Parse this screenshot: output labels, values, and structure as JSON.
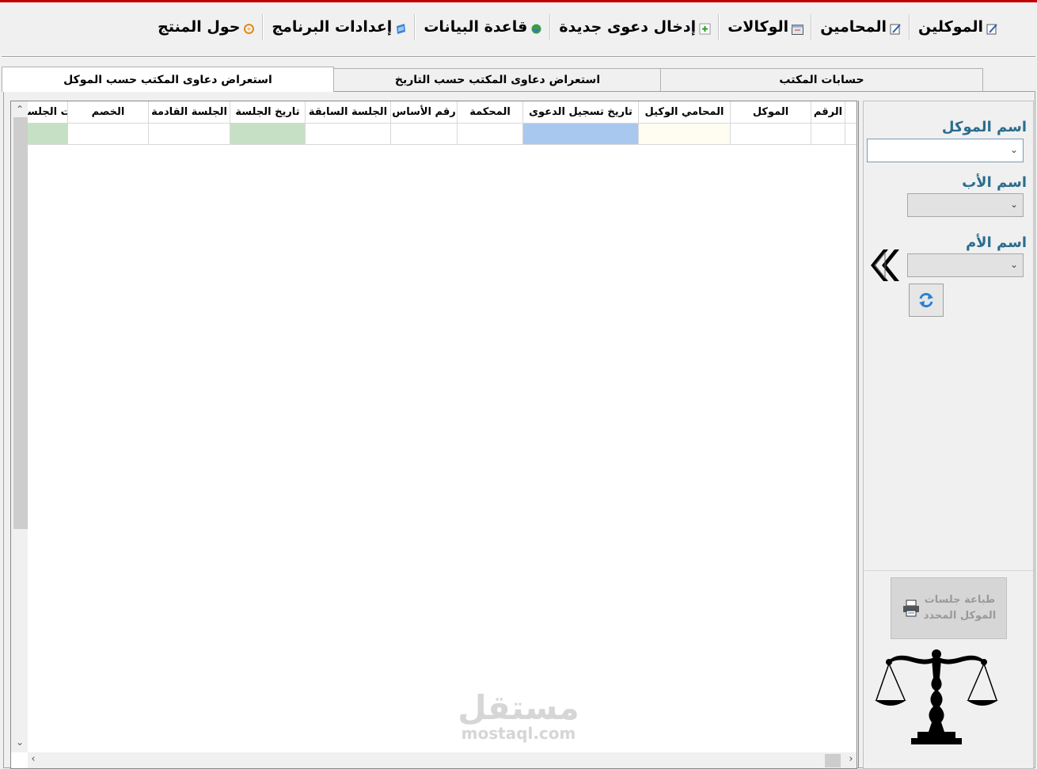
{
  "menu": {
    "items": [
      {
        "label": "الموكلين",
        "icon": "edit-icon"
      },
      {
        "label": "المحامين",
        "icon": "edit-icon"
      },
      {
        "label": "الوكالات",
        "icon": "window-icon"
      },
      {
        "label": "إدخال دعوى جديدة",
        "icon": "add-icon"
      },
      {
        "label": "قاعدة البيانات",
        "icon": "database-icon"
      },
      {
        "label": "إعدادات البرنامج",
        "icon": "settings-icon"
      },
      {
        "label": "حول المنتج",
        "icon": "info-icon"
      }
    ]
  },
  "tabs": [
    {
      "label": "استعراض دعاوى المكتب حسب الموكل",
      "active": true
    },
    {
      "label": "استعراض دعاوى المكتب حسب التاريخ",
      "active": false
    },
    {
      "label": "حسابات المكتب",
      "active": false
    }
  ],
  "grid": {
    "columns": [
      {
        "label": "الرقم",
        "cell_color": "#ffffff"
      },
      {
        "label": "الموكل",
        "cell_color": "#ffffff"
      },
      {
        "label": "المحامي الوكيل",
        "cell_color": "#fffcf2"
      },
      {
        "label": "تاريخ تسجيل الدعوى",
        "cell_color": "#a8c8ef"
      },
      {
        "label": "المحكمة",
        "cell_color": "#ffffff"
      },
      {
        "label": "رقم الأساس",
        "cell_color": "#ffffff"
      },
      {
        "label": "الجلسة السابقة",
        "cell_color": "#ffffff"
      },
      {
        "label": "تاريخ الجلسة",
        "cell_color": "#c6e0c6"
      },
      {
        "label": "الجلسة القادمة",
        "cell_color": "#ffffff"
      },
      {
        "label": "الخصم",
        "cell_color": "#ffffff"
      },
      {
        "label": "ملاحظات الجلسة",
        "cell_color": "#c6e0c6"
      }
    ]
  },
  "filters": {
    "client_name_label": "اسم الموكل",
    "father_name_label": "اسم الأب",
    "mother_name_label": "اسم الأم",
    "client_name_value": "",
    "father_name_value": "",
    "mother_name_value": ""
  },
  "print": {
    "line1": "طباعة جلسات",
    "line2": "الموكل المحدد"
  },
  "watermark": {
    "ar": "مستقل",
    "en": "mostaql.com"
  },
  "colors": {
    "accent_stripe": "#c00000",
    "label_color": "#2a6d8d"
  }
}
